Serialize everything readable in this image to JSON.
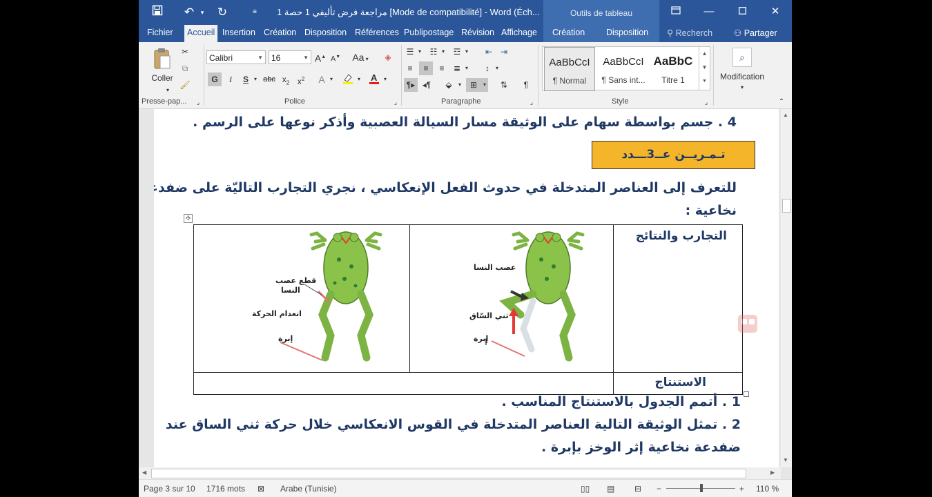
{
  "titlebar": {
    "title": "مراجعة فرض تأليفي 1 حصة 1 [Mode de compatibilité] - Word (Éch...",
    "context_tools": "Outils de tableau"
  },
  "tabs": {
    "file": "Fichier",
    "home": "Accueil",
    "insert": "Insertion",
    "design": "Création",
    "layout": "Disposition",
    "references": "Références",
    "mailings": "Publipostage",
    "review": "Révision",
    "view": "Affichage",
    "table_design": "Création",
    "table_layout": "Disposition",
    "search": "Recherch",
    "share": "Partager"
  },
  "ribbon": {
    "paste_label": "Coller",
    "clipboard_group": "Presse-pap...",
    "font_name": "Calibri",
    "font_size": "16",
    "aa_label": "Aa",
    "font_group": "Police",
    "paragraph_group": "Paragraphe",
    "styles": [
      {
        "sample": "AaBbCcI",
        "name": "¶ Normal"
      },
      {
        "sample": "AaBbCcI",
        "name": "¶ Sans int..."
      },
      {
        "sample": "AaBbC",
        "name": "Titre 1"
      }
    ],
    "style_group": "Style",
    "editing_label": "Modification"
  },
  "document": {
    "line_q4": "4 . جسم بواسطة سهام على الوثيقة مسار السيالة العصبية وأذكر نوعها على الرسم .",
    "exercise_title": "تـمـريــن عــ3ـــدد",
    "intro_line1": "للتعرف إلى العناصر المتدخلة في حدوث الفعل الإنعكاسي ، نجري التجارب التاليّة على ضفدعة",
    "intro_line2": "نخاعية :",
    "table": {
      "header_experiments": "التجارب والنتائج",
      "header_conclusion": "الاستنتاج",
      "frog1_labels": {
        "nerve": "عصب النسا",
        "bend": "ثني السّاق",
        "needle": "إبرة"
      },
      "frog2_labels": {
        "cut": "قطع عصب",
        "cut2": "النسا",
        "nomove": "انعدام الحركة",
        "needle": "إبرة"
      }
    },
    "q1": "1 . أتمم الجدول بالاستنتاج المناسب .",
    "q2_line1": "2 . تمثل الوثيقة التالية العناصر المتدخلة في القوس الانعكاسي خلال حركة ثني الساق عند",
    "q2_line2": "ضفدعة نخاعية إثر الوخز بإبرة ."
  },
  "statusbar": {
    "page": "Page 3 sur 10",
    "words": "1716 mots",
    "language": "Arabe (Tunisie)",
    "zoom": "110 %"
  },
  "colors": {
    "word_blue": "#2b579a",
    "exercise_fill": "#f5b52a",
    "doc_text": "#1f3864",
    "frog_green": "#7cb342"
  }
}
